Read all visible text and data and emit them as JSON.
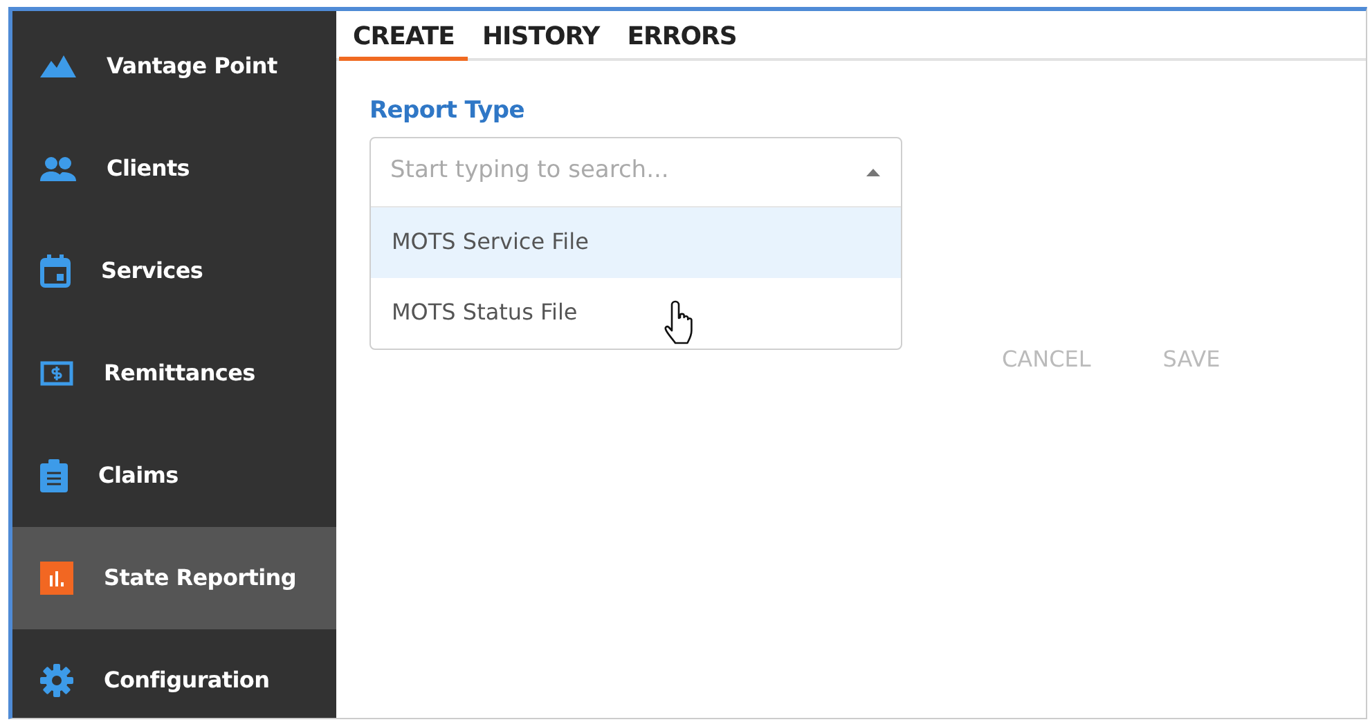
{
  "sidebar": {
    "items": [
      {
        "label": "Vantage Point",
        "selected": false
      },
      {
        "label": "Clients",
        "selected": false
      },
      {
        "label": "Services",
        "selected": false
      },
      {
        "label": "Remittances",
        "selected": false
      },
      {
        "label": "Claims",
        "selected": false
      },
      {
        "label": "State Reporting",
        "selected": true
      },
      {
        "label": "Configuration",
        "selected": false
      }
    ]
  },
  "tabs": [
    {
      "label": "CREATE",
      "selected": true
    },
    {
      "label": "HISTORY",
      "selected": false
    },
    {
      "label": "ERRORS",
      "selected": false
    }
  ],
  "report_type": {
    "label": "Report Type",
    "placeholder": "Start typing to search...",
    "expanded": true,
    "options": [
      {
        "label": "MOTS Service File",
        "highlighted": true
      },
      {
        "label": "MOTS Status File",
        "highlighted": false
      }
    ]
  },
  "buttons": [
    {
      "label": "CANCEL",
      "disabled": true
    },
    {
      "label": "SAVE",
      "disabled": true
    }
  ]
}
